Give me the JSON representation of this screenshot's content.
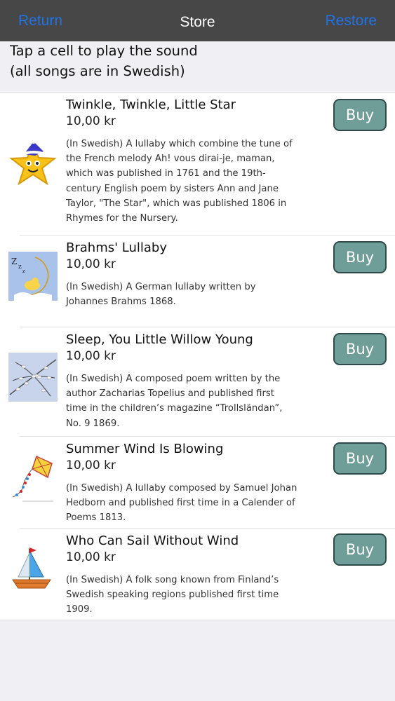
{
  "navbar": {
    "return_label": "Return",
    "title": "Store",
    "restore_label": "Restore"
  },
  "instructions": {
    "line1": "Tap a cell to play the sound",
    "line2": "(all songs are in Swedish)"
  },
  "songs": [
    {
      "title": "Twinkle, Twinkle, Little Star",
      "price": "10,00 kr",
      "description": "(In Swedish) A lullaby which combine the tune of the French melody Ah! vous dirai-je, maman, which was published in 1761 and the 19th-century English poem by sisters Ann and Jane Taylor, \"The Star\", which was published 1806 in Rhymes for the Nursery.",
      "buy_label": "Buy",
      "icon": "star-icon"
    },
    {
      "title": "Brahms' Lullaby",
      "price": "10,00 kr",
      "description": "(In Swedish) A German lullaby written by Johannes Brahms 1868.",
      "buy_label": "Buy",
      "icon": "sleeping-moon-icon"
    },
    {
      "title": "Sleep, You Little Willow Young",
      "price": "10,00 kr",
      "description": "(In Swedish) A composed poem written by the author Zacharias Topelius and published first time in the children’s magazine “Trollsländan”, No. 9 1869.",
      "buy_label": "Buy",
      "icon": "willow-branch-icon"
    },
    {
      "title": "Summer Wind Is Blowing",
      "price": "10,00 kr",
      "description": "(In Swedish) A lullaby composed by Samuel Johan Hedborn and published first time in a Calender of Poems 1813.",
      "buy_label": "Buy",
      "icon": "kite-icon"
    },
    {
      "title": "Who Can Sail Without Wind",
      "price": "10,00 kr",
      "description": "(In Swedish) A folk song known from Finland’s Swedish speaking regions published first time 1909.",
      "buy_label": "Buy",
      "icon": "sailboat-icon"
    }
  ]
}
